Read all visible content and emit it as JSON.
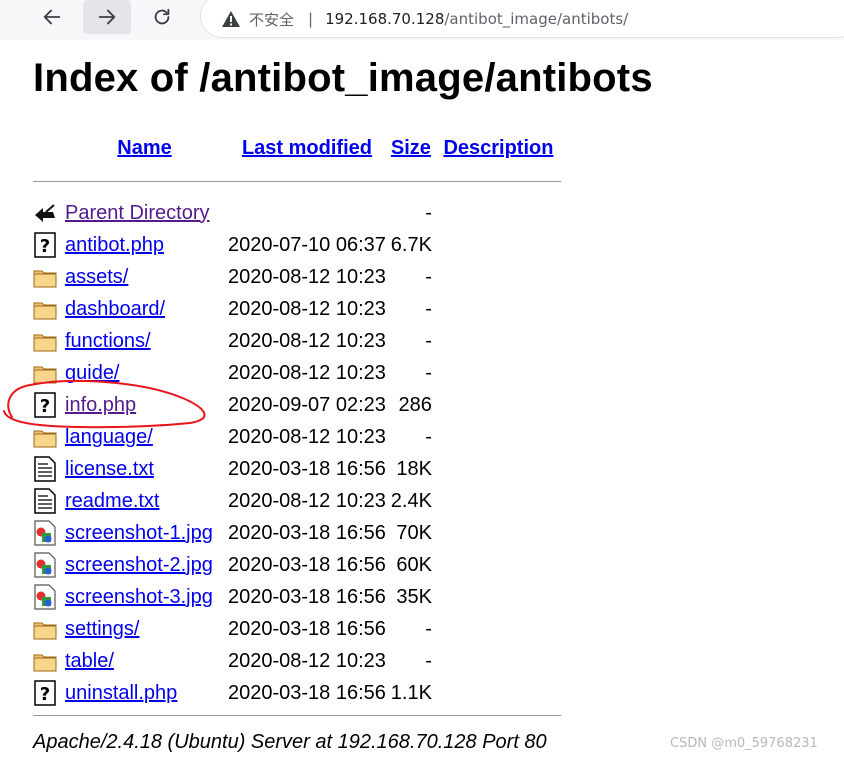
{
  "browser": {
    "insecure_label": "不安全",
    "url_host": "192.168.70.128",
    "url_path": "/antibot_image/antibots/"
  },
  "page": {
    "title": "Index of /antibot_image/antibots",
    "columns": {
      "name": "Name",
      "last_modified": "Last modified",
      "size": "Size",
      "description": "Description"
    },
    "parent": {
      "name": "Parent Directory",
      "size": "-"
    },
    "entries": [
      {
        "name": "antibot.php",
        "modified": "2020-07-10 06:37",
        "size": "6.7K",
        "icon": "unknown-file-icon"
      },
      {
        "name": "assets/",
        "modified": "2020-08-12 10:23",
        "size": "-",
        "icon": "folder-icon"
      },
      {
        "name": "dashboard/",
        "modified": "2020-08-12 10:23",
        "size": "-",
        "icon": "folder-icon"
      },
      {
        "name": "functions/",
        "modified": "2020-08-12 10:23",
        "size": "-",
        "icon": "folder-icon"
      },
      {
        "name": "guide/",
        "modified": "2020-08-12 10:23",
        "size": "-",
        "icon": "folder-icon"
      },
      {
        "name": "info.php",
        "modified": "2020-09-07 02:23",
        "size": "286",
        "icon": "unknown-file-icon",
        "visited": true
      },
      {
        "name": "language/",
        "modified": "2020-08-12 10:23",
        "size": "-",
        "icon": "folder-icon"
      },
      {
        "name": "license.txt",
        "modified": "2020-03-18 16:56",
        "size": "18K",
        "icon": "text-file-icon"
      },
      {
        "name": "readme.txt",
        "modified": "2020-08-12 10:23",
        "size": "2.4K",
        "icon": "text-file-icon"
      },
      {
        "name": "screenshot-1.jpg",
        "modified": "2020-03-18 16:56",
        "size": "70K",
        "icon": "image-file-icon"
      },
      {
        "name": "screenshot-2.jpg",
        "modified": "2020-03-18 16:56",
        "size": "60K",
        "icon": "image-file-icon"
      },
      {
        "name": "screenshot-3.jpg",
        "modified": "2020-03-18 16:56",
        "size": "35K",
        "icon": "image-file-icon"
      },
      {
        "name": "settings/",
        "modified": "2020-03-18 16:56",
        "size": "-",
        "icon": "folder-icon"
      },
      {
        "name": "table/",
        "modified": "2020-08-12 10:23",
        "size": "-",
        "icon": "folder-icon"
      },
      {
        "name": "uninstall.php",
        "modified": "2020-03-18 16:56",
        "size": "1.1K",
        "icon": "unknown-file-icon"
      }
    ],
    "footer": "Apache/2.4.18 (Ubuntu) Server at 192.168.70.128 Port 80"
  },
  "watermark": "CSDN @m0_59768231",
  "colors": {
    "link": "#0000ee",
    "visited_link": "#551a8b",
    "annotation_circle": "#e8151b"
  }
}
